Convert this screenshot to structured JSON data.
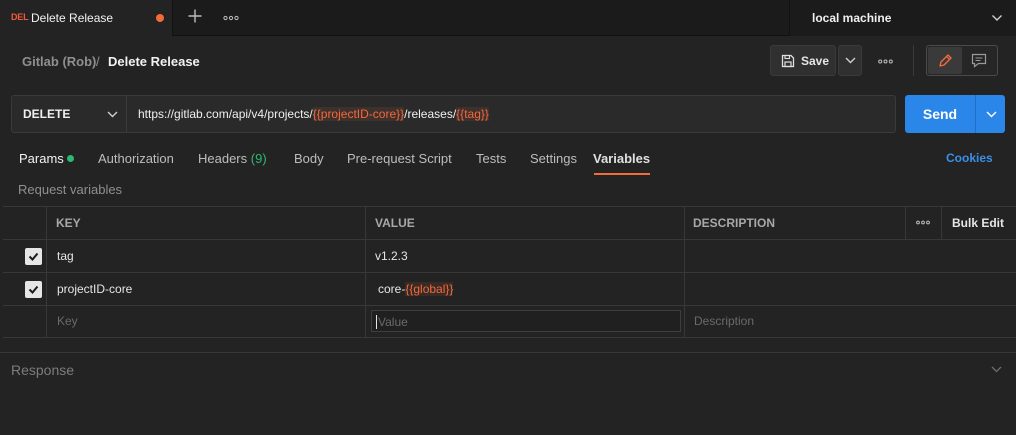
{
  "tabbar": {
    "tab": {
      "method": "DEL",
      "title": "Delete Release"
    },
    "environment": "local machine"
  },
  "breadcrumb": {
    "parent": "Gitlab (Rob)",
    "separator": "/",
    "current": "Delete Release"
  },
  "toolbar": {
    "save_label": "Save"
  },
  "request": {
    "method": "DELETE",
    "url_parts": [
      {
        "text": "https://gitlab.com/api/v4/projects/",
        "var": false
      },
      {
        "text": "{{projectID-core}}",
        "var": true
      },
      {
        "text": "/releases/",
        "var": false
      },
      {
        "text": "{{tag}}",
        "var": true
      }
    ],
    "send_label": "Send"
  },
  "tabs": {
    "params": "Params",
    "authorization": "Authorization",
    "headers": "Headers",
    "headers_count": "(9)",
    "body": "Body",
    "prerequest": "Pre-request Script",
    "tests": "Tests",
    "settings": "Settings",
    "variables": "Variables",
    "cookies": "Cookies"
  },
  "variables_section": {
    "title": "Request variables",
    "columns": {
      "key": "KEY",
      "value": "VALUE",
      "description": "DESCRIPTION",
      "bulk_edit": "Bulk Edit"
    },
    "rows": [
      {
        "checked": true,
        "key": "tag",
        "value_prefix": "v1.2.3",
        "value_var": ""
      },
      {
        "checked": true,
        "key": "projectID-core",
        "value_prefix": "core-",
        "value_var": "{{global}}"
      }
    ],
    "placeholders": {
      "key": "Key",
      "value": "Value",
      "description": "Description"
    }
  },
  "response": {
    "label": "Response"
  },
  "colors": {
    "accent": "#f26b3a",
    "send": "#2a86e8",
    "ok": "#2eb872",
    "link": "#3b8fe8"
  }
}
